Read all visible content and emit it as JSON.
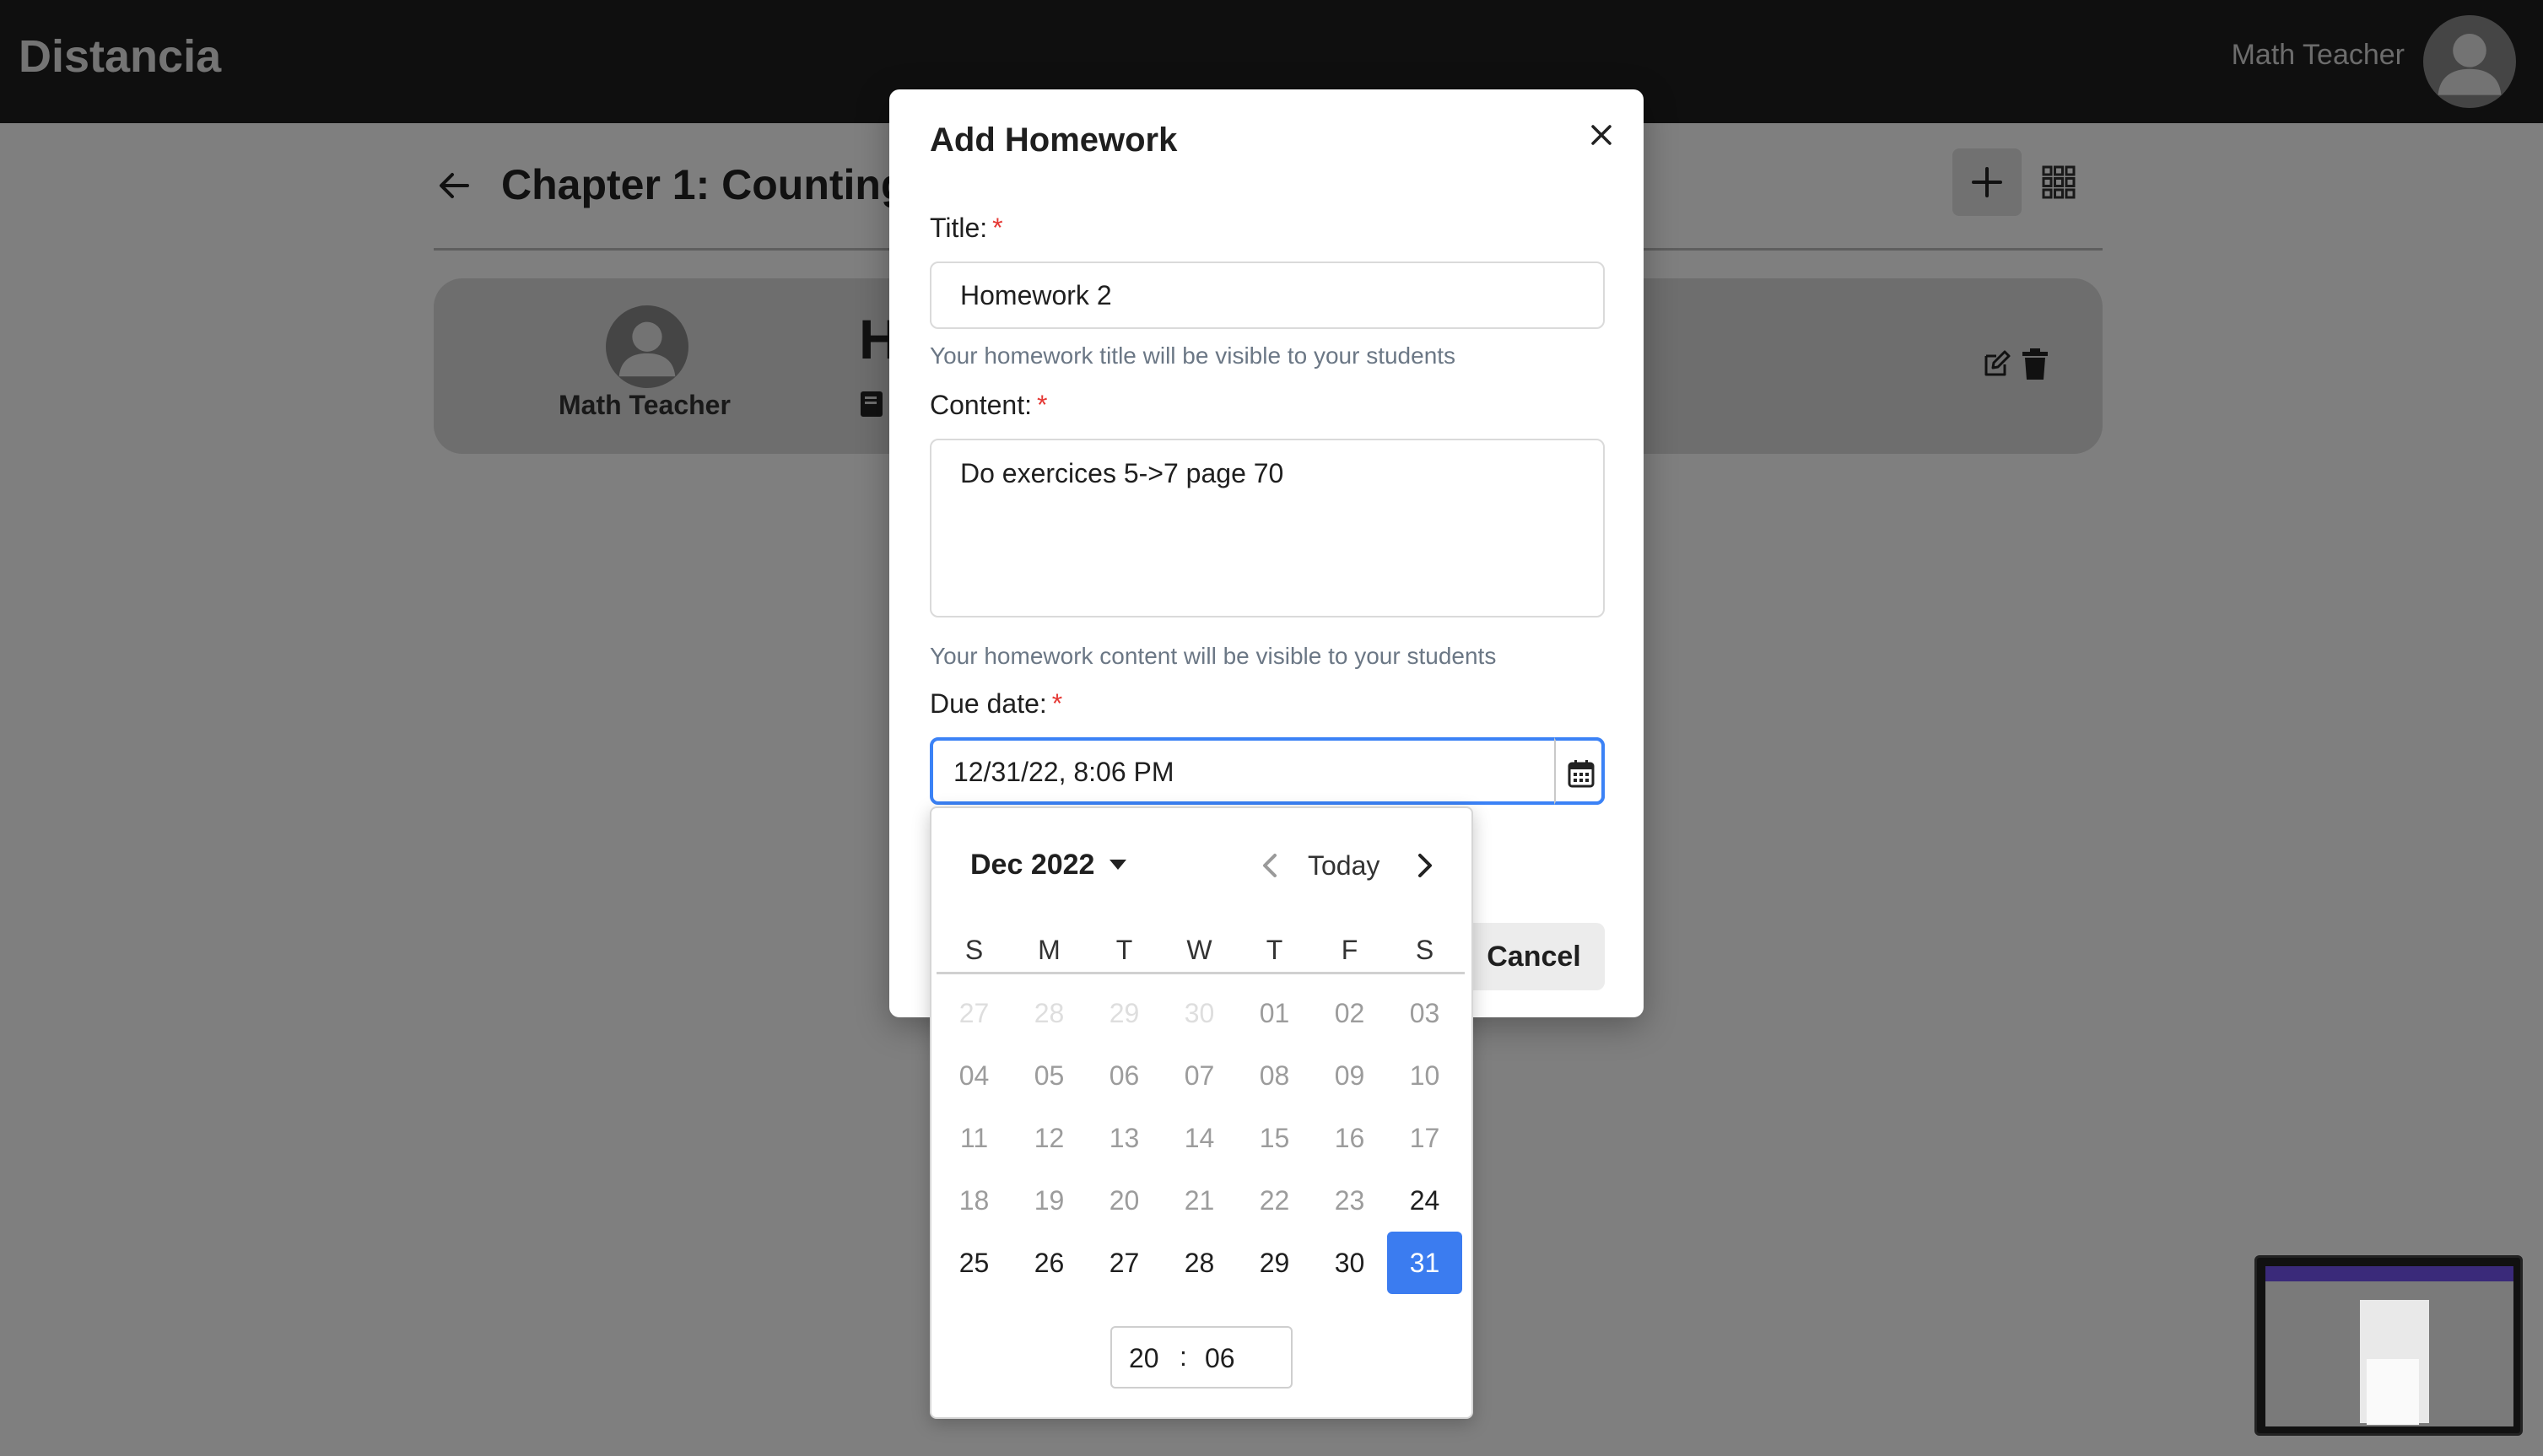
{
  "app": {
    "brand": "Distancia",
    "user_name": "Math Teacher"
  },
  "page": {
    "chapter_title": "Chapter 1: Counting"
  },
  "card": {
    "teacher": "Math Teacher",
    "homework_title_partial": "H"
  },
  "modal": {
    "title": "Add Homework",
    "title_label": "Title:",
    "title_value": "Homework 2",
    "title_helper": "Your homework title will be visible to your students",
    "content_label": "Content:",
    "content_value": "Do exercices 5->7 page 70",
    "content_helper": "Your homework content will be visible to your students",
    "due_label": "Due date:",
    "due_value": "12/31/22, 8:06 PM",
    "required_mark": "*",
    "cancel_label": "Cancel"
  },
  "datepicker": {
    "month_label": "Dec 2022",
    "today_label": "Today",
    "weekdays": [
      "S",
      "M",
      "T",
      "W",
      "T",
      "F",
      "S"
    ],
    "weeks": [
      [
        "27",
        "28",
        "29",
        "30",
        "01",
        "02",
        "03"
      ],
      [
        "04",
        "05",
        "06",
        "07",
        "08",
        "09",
        "10"
      ],
      [
        "11",
        "12",
        "13",
        "14",
        "15",
        "16",
        "17"
      ],
      [
        "18",
        "19",
        "20",
        "21",
        "22",
        "23",
        "24"
      ],
      [
        "25",
        "26",
        "27",
        "28",
        "29",
        "30",
        "31"
      ]
    ],
    "selected_day": "31",
    "time_hour": "20",
    "time_separator": ":",
    "time_minute": "06"
  },
  "icons": {
    "back": "arrow-left-icon",
    "add": "plus-icon",
    "grid": "grid-icon",
    "close": "close-icon",
    "calendar": "calendar-icon",
    "edit": "edit-icon",
    "delete": "trash-icon",
    "book": "book-icon"
  },
  "colors": {
    "accent": "#3b82f6",
    "selected_day": "#3b7cf0",
    "required": "#e53935",
    "topbar": "#1e1e1e"
  }
}
